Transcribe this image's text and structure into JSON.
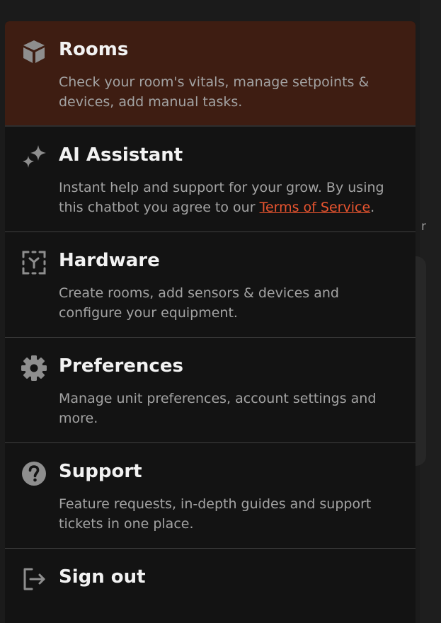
{
  "background": {
    "partial_text": "r"
  },
  "menu": {
    "items": [
      {
        "id": "rooms",
        "icon": "cube-icon",
        "title": "Rooms",
        "description": "Check your room's vitals, manage setpoints & devices, add manual tasks.",
        "active": true
      },
      {
        "id": "ai-assistant",
        "icon": "sparkles-icon",
        "title": "AI Assistant",
        "description_before": "Instant help and support for your grow. By using this chatbot you agree to our ",
        "link_label": "Terms of Service",
        "description_after": "."
      },
      {
        "id": "hardware",
        "icon": "scan-device-icon",
        "title": "Hardware",
        "description": "Create rooms, add sensors & devices and configure your equipment."
      },
      {
        "id": "preferences",
        "icon": "gear-icon",
        "title": "Preferences",
        "description": "Manage unit preferences, account settings and more."
      },
      {
        "id": "support",
        "icon": "question-circle-icon",
        "title": "Support",
        "description": "Feature requests, in-depth guides and support tickets in one place."
      },
      {
        "id": "sign-out",
        "icon": "sign-out-icon",
        "title": "Sign out"
      }
    ]
  },
  "colors": {
    "active_background": "#3e1d12",
    "panel_background": "#131313",
    "link": "#e8542f",
    "title_text": "#f2f2f2",
    "description_text": "#a3a3a3",
    "icon": "#8e8e8e"
  }
}
